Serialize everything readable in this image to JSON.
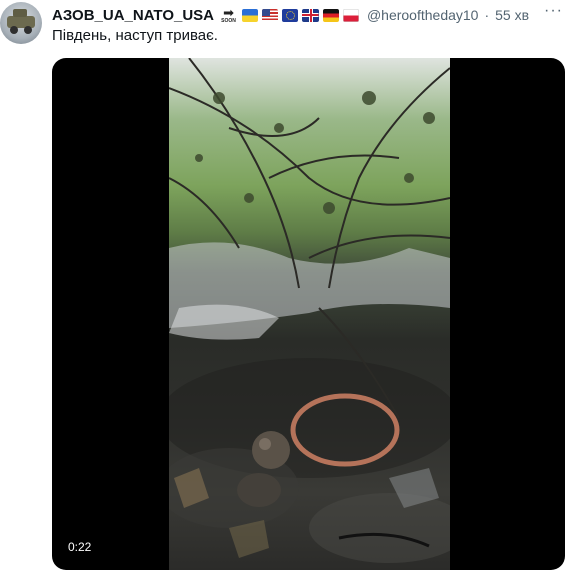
{
  "tweet": {
    "display_name": "АЗОВ_UA_NATO_USA",
    "soon_label": "SOON",
    "flags": [
      "flag-ukraine-icon",
      "flag-usa-icon",
      "flag-eu-icon",
      "flag-uk-icon",
      "flag-germany-icon",
      "flag-poland-icon"
    ],
    "handle": "@herooftheday10",
    "separator": "·",
    "time": "55 хв",
    "more_label": "···",
    "text": "Південь, наступ триває."
  },
  "media": {
    "duration": "0:22"
  },
  "colors": {
    "text_primary": "#0f1419",
    "text_secondary": "#536471",
    "media_bg": "#000000"
  }
}
